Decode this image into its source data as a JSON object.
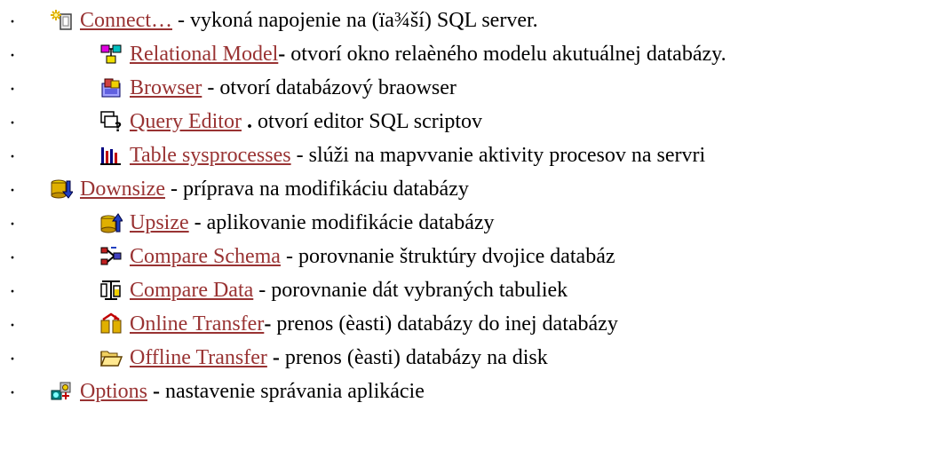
{
  "items": [
    {
      "bullet": "·",
      "icon": "connect-icon",
      "link": "Connect…",
      "sep": " - ",
      "sep_bold": false,
      "desc": "vykoná napojenie na (ïa¾ší) SQL server."
    },
    {
      "bullet": "·",
      "icon": "relational-model-icon",
      "link": "Relational Model",
      "sep": "- ",
      "sep_bold": true,
      "desc": "otvorí okno relaèného modelu akutuálnej databázy."
    },
    {
      "bullet": "·",
      "icon": "browser-icon",
      "link": "Browser",
      "sep": " - ",
      "sep_bold": false,
      "desc": "otvorí databázový braowser"
    },
    {
      "bullet": "·",
      "icon": "query-editor-icon",
      "link": "Query Editor",
      "sep": " . ",
      "sep_bold": true,
      "desc": "otvorí editor SQL scriptov"
    },
    {
      "bullet": "·",
      "icon": "table-sysprocesses-icon",
      "link": "Table sysprocesses",
      "sep": " - ",
      "sep_bold": false,
      "desc": "slúži na mapvvanie aktivity procesov na servri"
    },
    {
      "bullet": "·",
      "icon": "downsize-icon",
      "link": "Downsize",
      "sep": " - ",
      "sep_bold": false,
      "desc": "príprava na modifikáciu databázy"
    },
    {
      "bullet": "·",
      "icon": "upsize-icon",
      "link": "Upsize",
      "sep": " - ",
      "sep_bold": false,
      "desc": "aplikovanie modifikácie databázy"
    },
    {
      "bullet": "·",
      "icon": "compare-schema-icon",
      "link": "Compare Schema",
      "sep": " - ",
      "sep_bold": false,
      "desc": "porovnanie štruktúry dvojice databáz"
    },
    {
      "bullet": "·",
      "icon": "compare-data-icon",
      "link": "Compare Data",
      "sep": " - ",
      "sep_bold": false,
      "desc": "porovnanie dát vybraných tabuliek"
    },
    {
      "bullet": "·",
      "icon": "online-transfer-icon",
      "link": "Online Transfer",
      "sep": "- ",
      "sep_bold": true,
      "desc": "prenos (èasti) databázy do inej databázy"
    },
    {
      "bullet": "·",
      "icon": "offline-transfer-icon",
      "link": "Offline Transfer",
      "sep": " - ",
      "sep_bold": true,
      "desc": "prenos (èasti) databázy na disk"
    },
    {
      "bullet": "·",
      "icon": "options-icon",
      "link": "Options",
      "sep": " - ",
      "sep_bold": true,
      "desc": "nastavenie správania aplikácie"
    }
  ]
}
